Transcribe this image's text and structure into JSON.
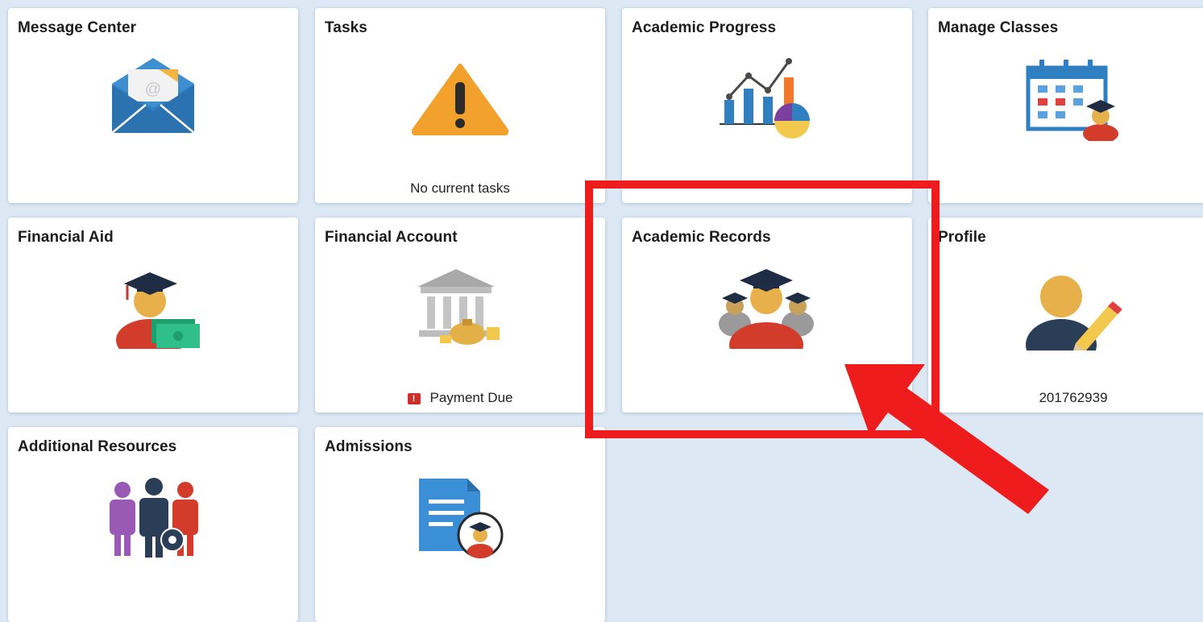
{
  "tiles": [
    {
      "title": "Message Center",
      "icon": "envelope-icon"
    },
    {
      "title": "Tasks",
      "icon": "warning-icon",
      "footer": "No current tasks"
    },
    {
      "title": "Academic Progress",
      "icon": "chart-icon"
    },
    {
      "title": "Manage Classes",
      "icon": "calendar-student-icon"
    },
    {
      "title": "Financial Aid",
      "icon": "graduate-money-icon"
    },
    {
      "title": "Financial Account",
      "icon": "bank-icon",
      "footer_flag": "!",
      "footer": "Payment Due"
    },
    {
      "title": "Academic Records",
      "icon": "graduates-group-icon"
    },
    {
      "title": "Profile",
      "icon": "user-edit-icon",
      "footer": "201762939"
    },
    {
      "title": "Additional Resources",
      "icon": "people-gear-icon"
    },
    {
      "title": "Admissions",
      "icon": "document-graduate-icon"
    }
  ],
  "annotation": {
    "highlight_color": "#ee1c1c",
    "target": "Academic Records"
  }
}
